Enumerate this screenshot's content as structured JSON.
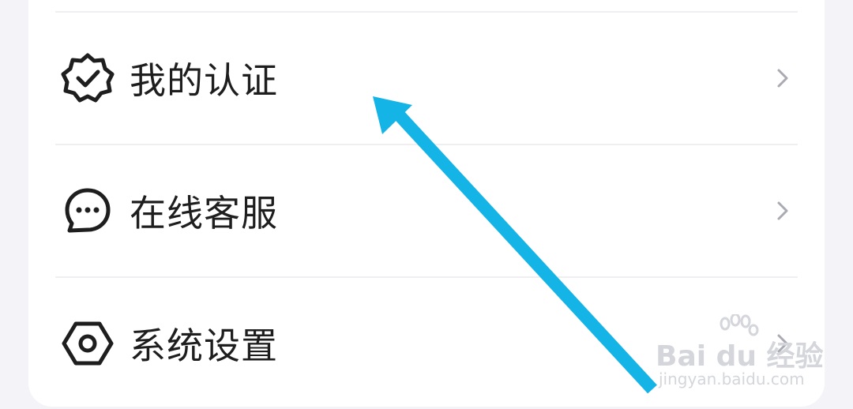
{
  "menu": {
    "items": [
      {
        "label": "我的认证",
        "icon": "verified-badge-icon"
      },
      {
        "label": "在线客服",
        "icon": "chat-bubble-icon"
      },
      {
        "label": "系统设置",
        "icon": "settings-hexagon-icon"
      }
    ]
  },
  "colors": {
    "card_background": "#ffffff",
    "page_background": "#f4f4f8",
    "label_text": "#1e1e1e",
    "chevron": "#a9aab2",
    "divider": "#efeff2",
    "annotation_arrow": "#14b4e6",
    "watermark": "#d4d6dc"
  },
  "watermark": {
    "brand": "Bai du 经验",
    "url": "jingyan.baidu.com"
  }
}
